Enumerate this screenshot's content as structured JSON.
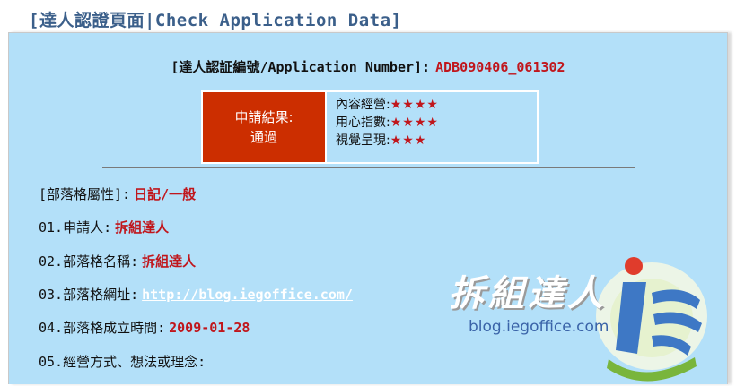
{
  "header": {
    "title": "[達人認證頁面|Check Application Data]"
  },
  "application": {
    "label": "[達人認証編號/Application Number]:",
    "number": "ADB090406_061302"
  },
  "result": {
    "label_line1": "申請結果:",
    "label_line2": "通過",
    "ratings": [
      {
        "label": "內容經營:",
        "stars": "★★★★",
        "count": 4
      },
      {
        "label": "用心指數:",
        "stars": "★★★★",
        "count": 4
      },
      {
        "label": "視覺呈現:",
        "stars": "★★★",
        "count": 3
      }
    ]
  },
  "fields": {
    "category": {
      "label": "[部落格屬性]:",
      "value": "日記/一般"
    },
    "applicant": {
      "label": "01.申請人:",
      "value": "拆組達人"
    },
    "blog_name": {
      "label": "02.部落格名稱:",
      "value": "拆組達人"
    },
    "blog_url": {
      "label": "03.部落格網址:",
      "value": "http://blog.iegoffice.com/"
    },
    "established": {
      "label": "04.部落格成立時間:",
      "value": "2009-01-28"
    },
    "philosophy": {
      "label": "05.經營方式、想法或理念:"
    }
  },
  "logo": {
    "name": "拆組達人",
    "url": "blog.iegoffice.com"
  },
  "colors": {
    "panel_bg": "#b3e0f9",
    "accent_red": "#c0161c",
    "result_bg": "#cc2e00",
    "title_blue": "#3b5f8a"
  }
}
